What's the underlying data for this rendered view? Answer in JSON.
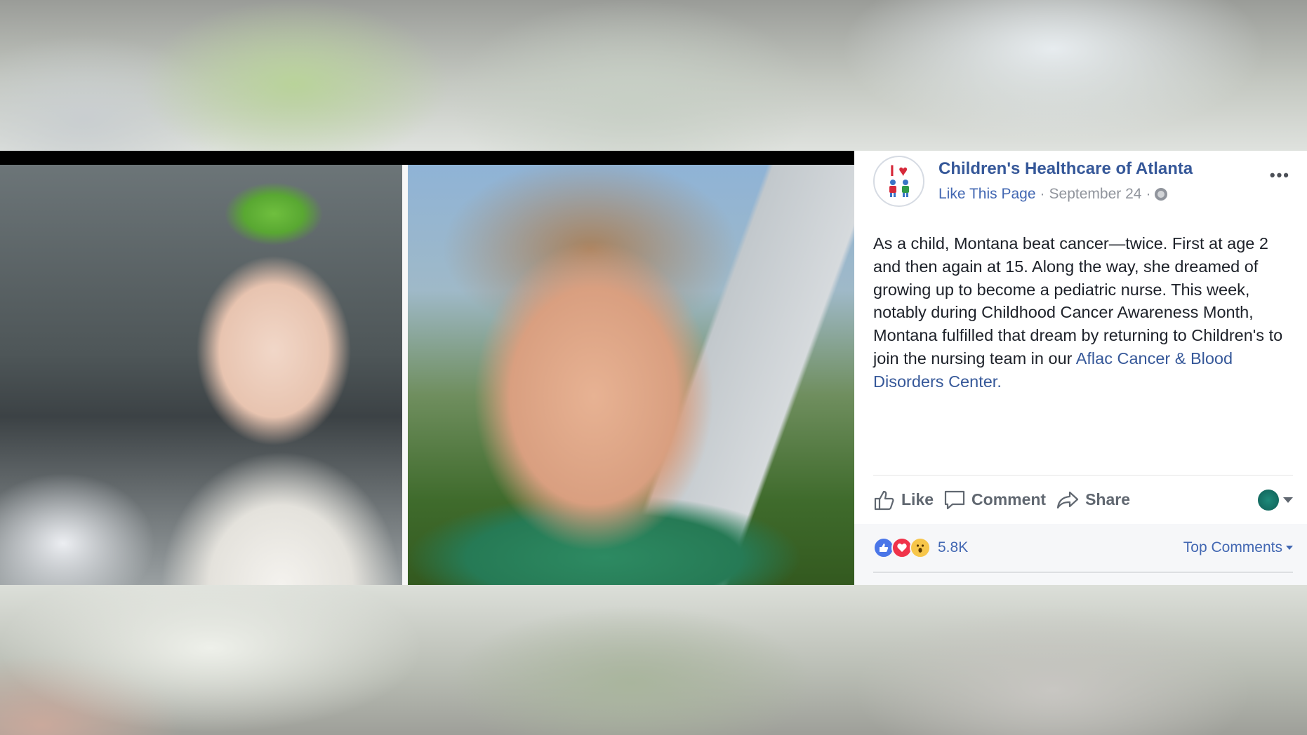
{
  "post": {
    "page_name": "Children's Healthcare of Atlanta",
    "like_page": "Like This Page",
    "separator": "·",
    "date": "September 24",
    "separator2": "·",
    "more": "•••",
    "body_text": "As a child, Montana beat cancer—twice. First at age 2 and then again at 15. Along the way, she dreamed of growing up to become a pediatric nurse. This week, notably during Childhood Cancer Awareness Month, Montana fulfilled that dream by returning to Children's to join the nursing team in our ",
    "body_link": "Aflac Cancer & Blood Disorders Center.",
    "actions": {
      "like": "Like",
      "comment": "Comment",
      "share": "Share"
    },
    "reactions": {
      "count": "5.8K",
      "types": [
        "like",
        "love",
        "wow"
      ]
    },
    "top_comments": "Top Comments"
  },
  "avatar": {
    "logo_text": "I ♥",
    "kids_glyph": "🧍🧍"
  },
  "colors": {
    "link": "#365899",
    "meta": "#90949c",
    "text": "#1d2129",
    "like_reaction": "#4a76e8",
    "love_reaction": "#f0334a",
    "wow_reaction": "#f7c64a"
  },
  "icons": [
    "thumbs-up-icon",
    "comment-icon",
    "share-icon",
    "globe-icon",
    "more-icon",
    "caret-down-icon"
  ]
}
